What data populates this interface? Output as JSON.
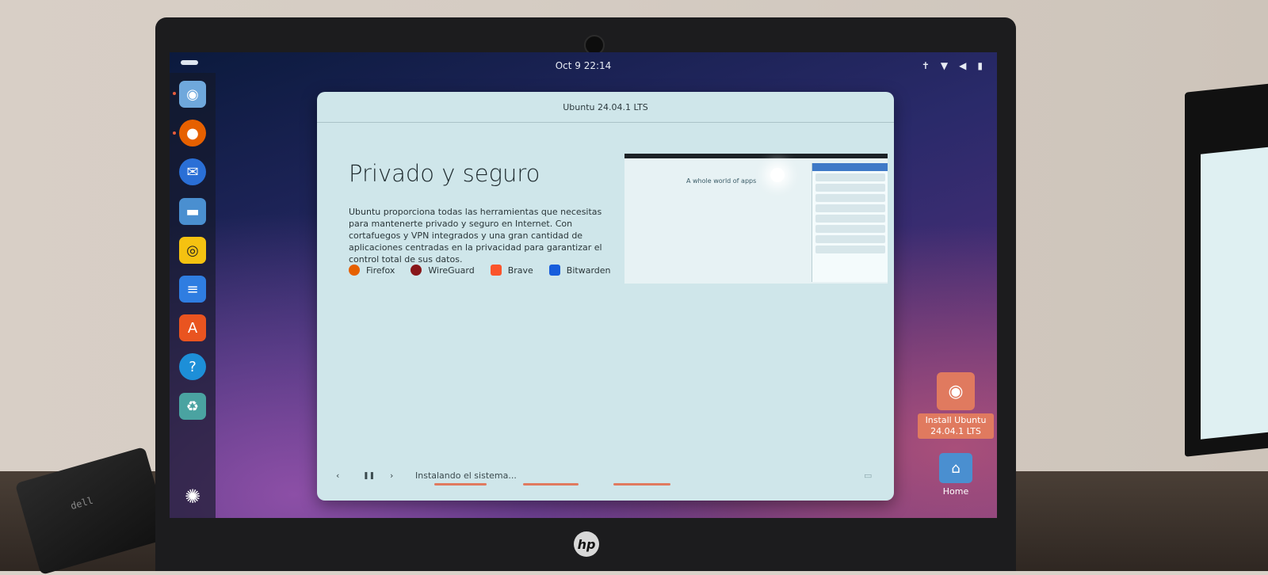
{
  "topbar": {
    "clock": "Oct 9  22:14",
    "tray_icons": [
      "accessibility-icon",
      "wifi-icon",
      "volume-icon",
      "battery-icon"
    ]
  },
  "dock": {
    "items": [
      {
        "name": "install-ubuntu",
        "icon": "installer-icon",
        "color": "#3a7bd5"
      },
      {
        "name": "firefox",
        "icon": "firefox-icon",
        "color": "#e66000"
      },
      {
        "name": "thunderbird",
        "icon": "thunderbird-icon",
        "color": "#2a6fd6"
      },
      {
        "name": "files",
        "icon": "folder-icon",
        "color": "#4a8fd0"
      },
      {
        "name": "rhythmbox",
        "icon": "speaker-icon",
        "color": "#f5c211"
      },
      {
        "name": "libreoffice-writer",
        "icon": "document-icon",
        "color": "#2f7de1"
      },
      {
        "name": "app-center",
        "icon": "app-store-icon",
        "color": "#e95420"
      },
      {
        "name": "help",
        "icon": "help-icon",
        "color": "#1d8fd8"
      },
      {
        "name": "trash",
        "icon": "trash-icon",
        "color": "#4aa3a1"
      },
      {
        "name": "show-apps",
        "icon": "ubuntu-logo-icon",
        "color": "#ffffff"
      }
    ]
  },
  "desktop": {
    "install_label": "Install Ubuntu 24.04.1 LTS",
    "home_label": "Home"
  },
  "installer": {
    "window_title": "Ubuntu 24.04.1 LTS",
    "heading": "Privado y seguro",
    "body": "Ubuntu proporciona todas las herramientas que necesitas para mantenerte privado y seguro en Internet. Con cortafuegos y VPN integrados y una gran cantidad de aplicaciones centradas en la privacidad para garantizar el control total de sus datos.",
    "apps": [
      {
        "label": "Firefox",
        "icon": "firefox-icon",
        "color": "#e66000"
      },
      {
        "label": "WireGuard",
        "icon": "wireguard-icon",
        "color": "#88171a"
      },
      {
        "label": "Brave",
        "icon": "brave-icon",
        "color": "#fb542b"
      },
      {
        "label": "Bitwarden",
        "icon": "bitwarden-icon",
        "color": "#175ddc"
      }
    ],
    "preview_caption": "A whole world of apps",
    "status": "Instalando el sistema...",
    "controls": {
      "prev": "‹",
      "pause": "❚❚",
      "next": "›"
    }
  },
  "hardware": {
    "brand": "hp",
    "charger_text": "dell"
  }
}
